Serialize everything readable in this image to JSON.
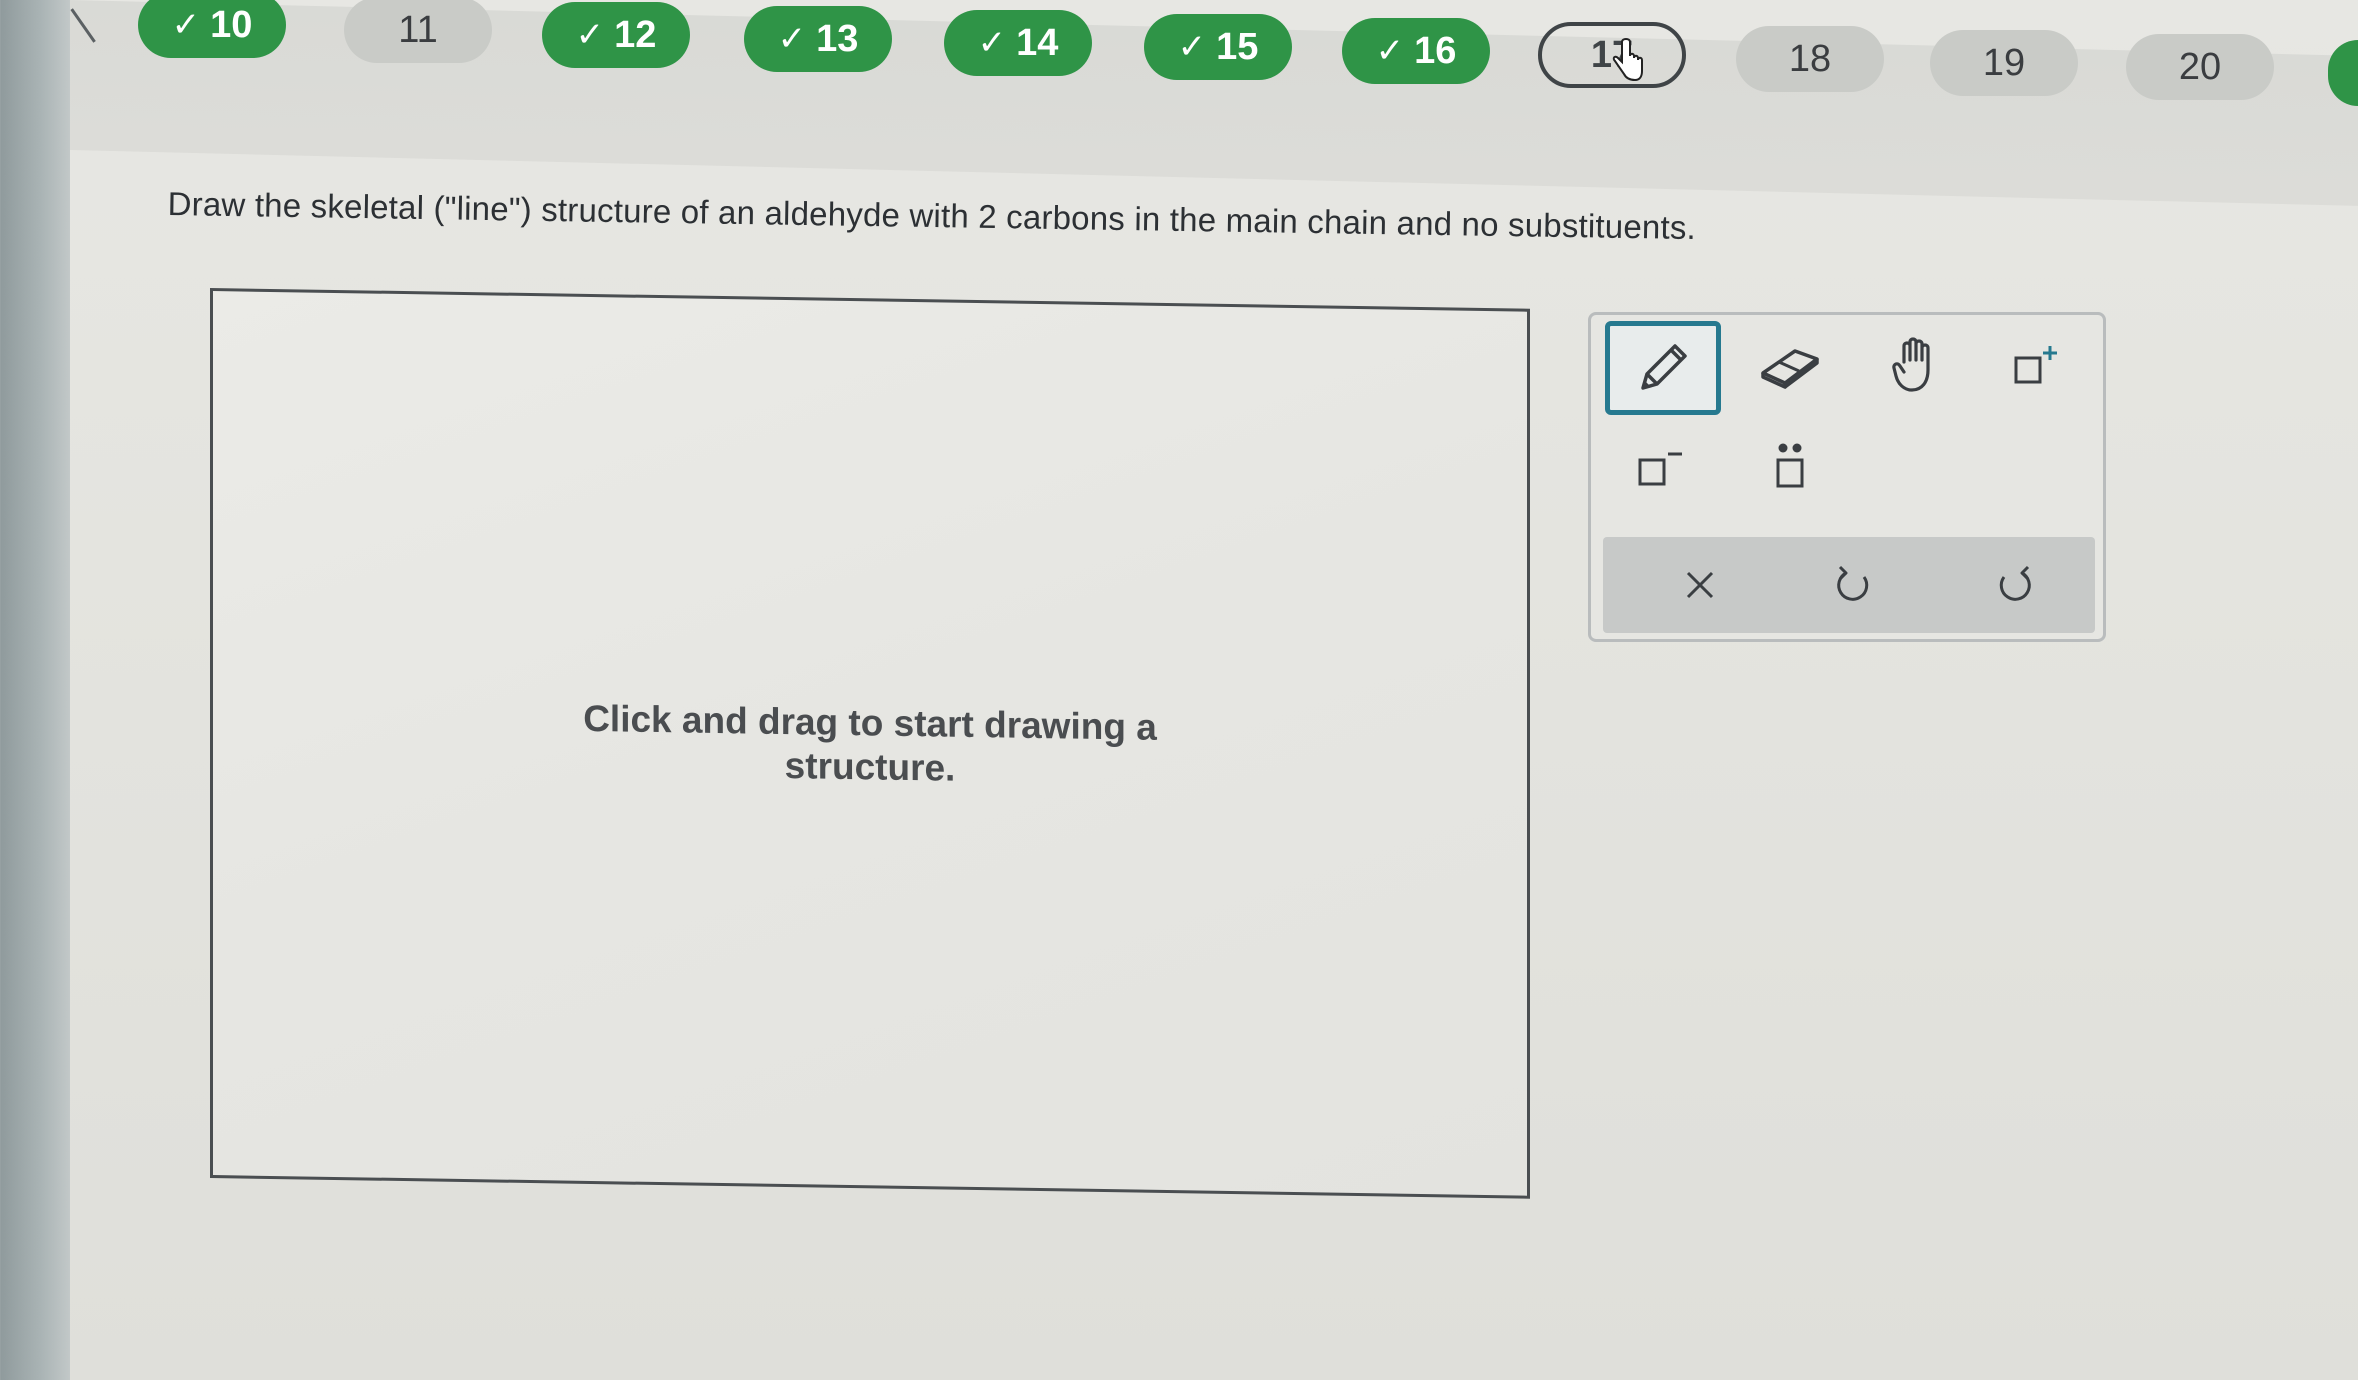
{
  "nav": {
    "back_icon": "chevron-left-icon",
    "questions": [
      {
        "number": "10",
        "status": "done"
      },
      {
        "number": "11",
        "status": "todo"
      },
      {
        "number": "12",
        "status": "done"
      },
      {
        "number": "13",
        "status": "done"
      },
      {
        "number": "14",
        "status": "done"
      },
      {
        "number": "15",
        "status": "done"
      },
      {
        "number": "16",
        "status": "done"
      },
      {
        "number": "17",
        "status": "current"
      },
      {
        "number": "18",
        "status": "todo"
      },
      {
        "number": "19",
        "status": "todo"
      },
      {
        "number": "20",
        "status": "todo"
      }
    ],
    "check_glyph": "✓",
    "colors": {
      "done": "#2f9447",
      "todo": "#c9cbc7",
      "current_border": "#3f4447"
    }
  },
  "question": {
    "text": "Draw the skeletal (\"line\") structure of an aldehyde with 2 carbons in the main chain and no substituents."
  },
  "canvas": {
    "hint_line1": "Click and drag to start drawing a",
    "hint_line2": "structure."
  },
  "toolbox": {
    "tools": [
      {
        "name": "pencil-tool",
        "icon": "pencil-icon",
        "active": true
      },
      {
        "name": "eraser-tool",
        "icon": "eraser-icon",
        "active": false
      },
      {
        "name": "hand-tool",
        "icon": "hand-icon",
        "active": false
      },
      {
        "name": "positive-charge-tool",
        "icon": "positive-charge-icon",
        "active": false
      },
      {
        "name": "negative-charge-tool",
        "icon": "negative-charge-icon",
        "active": false
      },
      {
        "name": "lone-pair-tool",
        "icon": "lone-pair-icon",
        "active": false
      }
    ],
    "actions": [
      {
        "name": "clear-button",
        "icon": "close-icon"
      },
      {
        "name": "undo-button",
        "icon": "undo-icon"
      },
      {
        "name": "redo-button",
        "icon": "redo-icon"
      }
    ],
    "accent_color": "#26798f"
  }
}
